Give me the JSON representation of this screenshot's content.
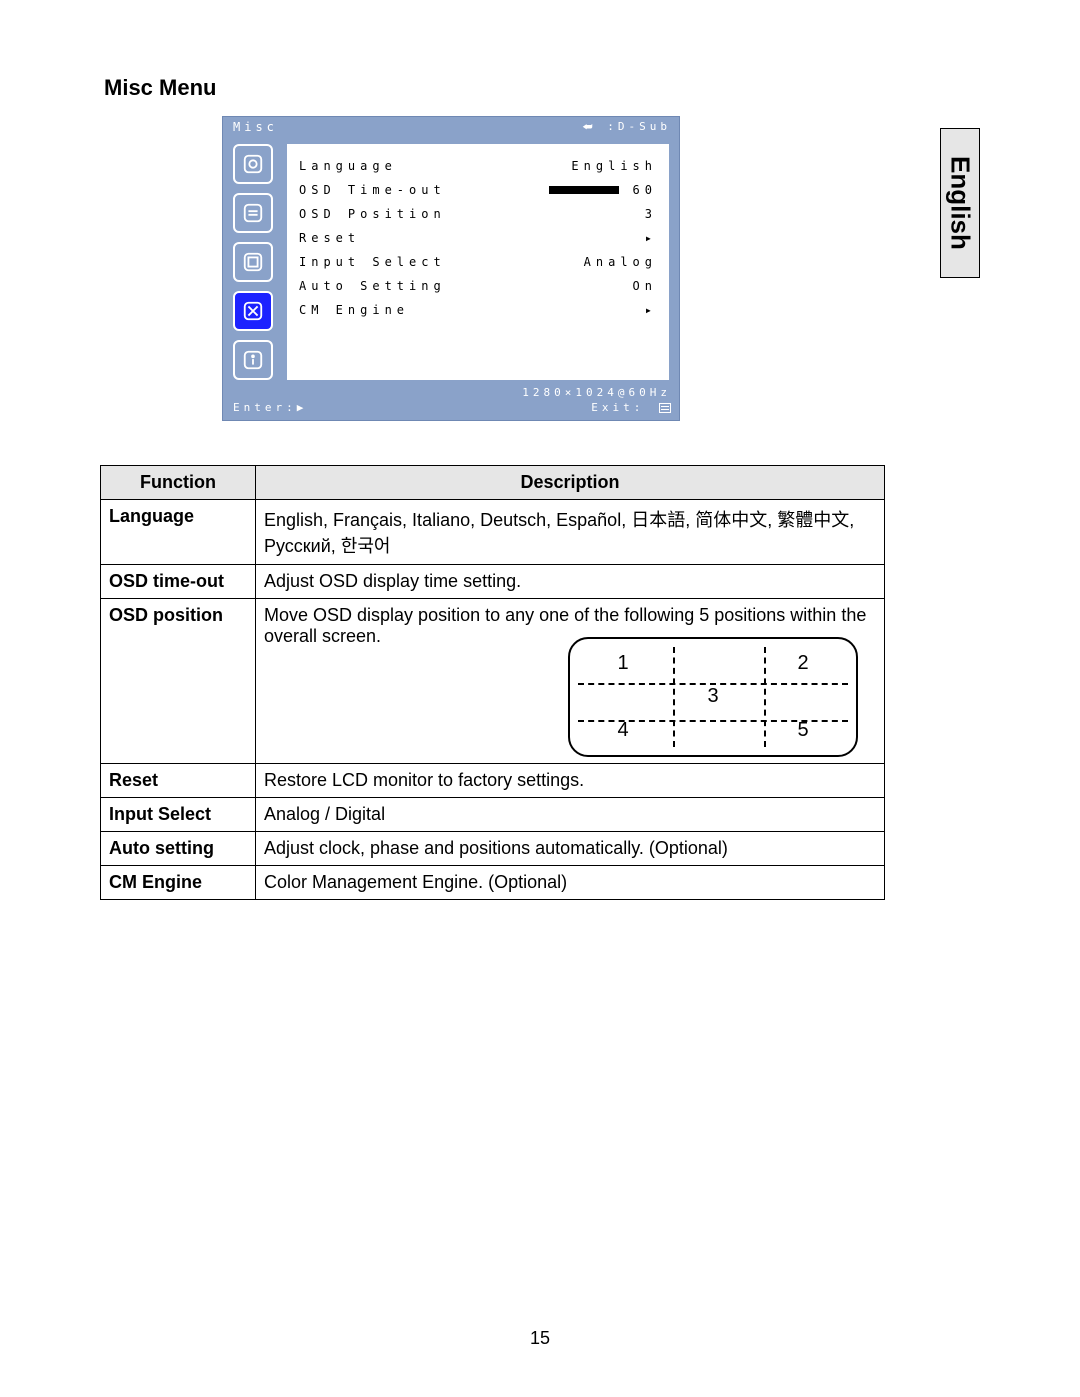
{
  "section_title": "Misc Menu",
  "language_tab": "English",
  "page_number": "15",
  "osd": {
    "title_left": "Misc",
    "title_right": "⮨ :D-Sub",
    "resolution": "1280×1024@60Hz",
    "enter_label": "Enter:▶",
    "exit_label": "Exit:",
    "rows": [
      {
        "label": "Language",
        "value": "English"
      },
      {
        "label": "OSD Time-out",
        "value": "60"
      },
      {
        "label": "OSD Position",
        "value": "3"
      },
      {
        "label": "Reset",
        "value": "▸"
      },
      {
        "label": "Input Select",
        "value": "Analog"
      },
      {
        "label": "Auto Setting",
        "value": "On"
      },
      {
        "label": "CM Engine",
        "value": "▸"
      }
    ]
  },
  "table": {
    "header_function": "Function",
    "header_description": "Description",
    "rows": [
      {
        "fn": "Language",
        "desc": "English, Français, Italiano, Deutsch, Español,  日本語,  简体中文,  繁體中文, Русский,  한국어"
      },
      {
        "fn": "OSD time-out",
        "desc": "Adjust OSD display time setting."
      },
      {
        "fn": "OSD position",
        "desc": "Move OSD display position to any one of the following 5 positions within the overall screen."
      },
      {
        "fn": "Reset",
        "desc": "Restore LCD monitor to factory settings."
      },
      {
        "fn": "Input Select",
        "desc": "Analog / Digital"
      },
      {
        "fn": "Auto setting",
        "desc": "Adjust clock, phase and positions automatically. (Optional)"
      },
      {
        "fn": "CM Engine",
        "desc": "Color Management Engine. (Optional)"
      }
    ],
    "positions": {
      "p1": "1",
      "p2": "2",
      "p3": "3",
      "p4": "4",
      "p5": "5"
    }
  }
}
